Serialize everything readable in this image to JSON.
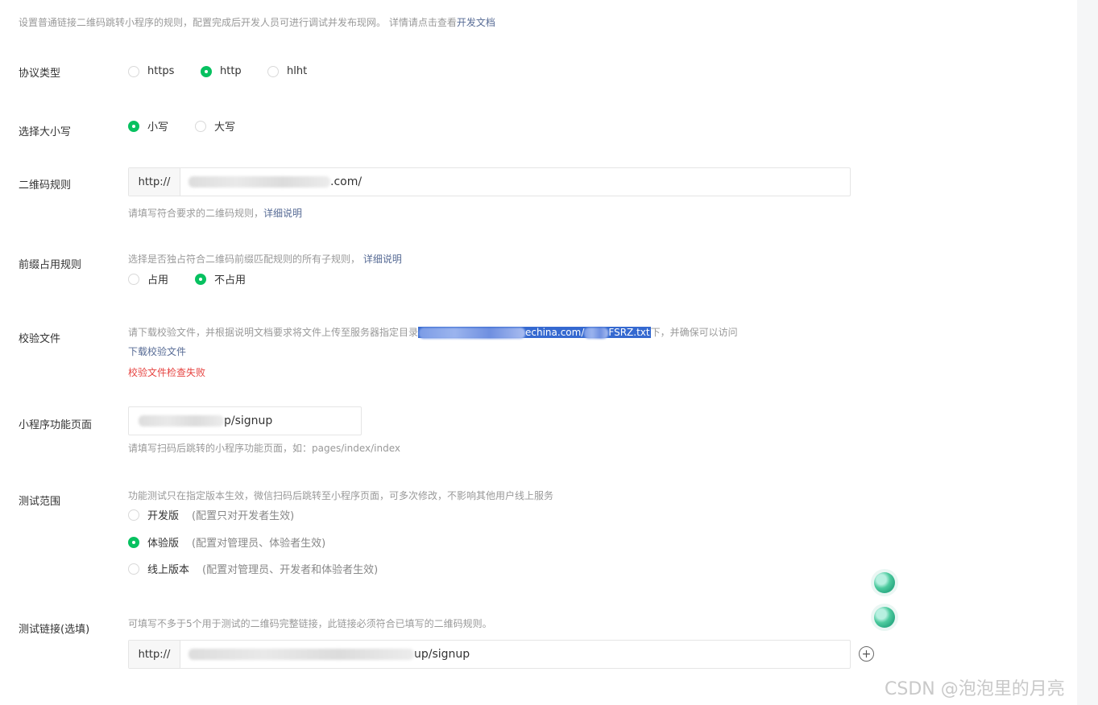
{
  "intro": {
    "text": "设置普通链接二维码跳转小程序的规则，配置完成后开发人员可进行调试并发布现网。 详情请点击查看",
    "link": "开发文档"
  },
  "protocol": {
    "label": "协议类型",
    "options": [
      "https",
      "http",
      "hlht"
    ],
    "selected": "http"
  },
  "case": {
    "label": "选择大小写",
    "options": [
      "小写",
      "大写"
    ],
    "selected": "小写"
  },
  "qr_rule": {
    "label": "二维码规则",
    "prefix": "http://",
    "value_suffix": ".com/",
    "hint": "请填写符合要求的二维码规则，",
    "hint_link": "详细说明"
  },
  "prefix_rule": {
    "label": "前缀占用规则",
    "desc": "选择是否独占符合二维码前缀匹配规则的所有子规则，",
    "desc_link": "详细说明",
    "options": [
      "占用",
      "不占用"
    ],
    "selected": "不占用"
  },
  "verify_file": {
    "label": "校验文件",
    "desc_before": "请下载校验文件，并根据说明文档要求将文件上传至服务器指定目录",
    "selected_mid": "echina.com/",
    "selected_end": "FSRZ.txt",
    "desc_after": "下，并确保可以访问",
    "download_link": "下载校验文件",
    "error": "校验文件检查失败"
  },
  "mp_page": {
    "label": "小程序功能页面",
    "value_suffix": "p/signup",
    "hint": "请填写扫码后跳转的小程序功能页面，如：pages/index/index"
  },
  "test_scope": {
    "label": "测试范围",
    "desc": "功能测试只在指定版本生效，微信扫码后跳转至小程序页面，可多次修改，不影响其他用户线上服务",
    "options": [
      {
        "name": "开发版",
        "note": "(配置只对开发者生效)"
      },
      {
        "name": "体验版",
        "note": "(配置对管理员、体验者生效)"
      },
      {
        "name": "线上版本",
        "note": "(配置对管理员、开发者和体验者生效)"
      }
    ],
    "selected": "体验版"
  },
  "test_link": {
    "label": "测试链接(选填)",
    "desc": "可填写不多于5个用于测试的二维码完整链接，此链接必须符合已填写的二维码规则。",
    "prefix": "http://",
    "value_suffix": "up/signup",
    "add_symbol": "+"
  },
  "watermark": "CSDN @泡泡里的月亮"
}
